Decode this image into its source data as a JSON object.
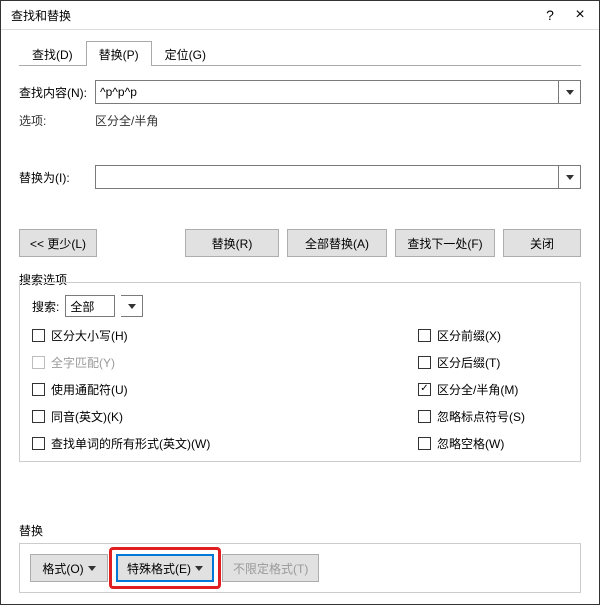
{
  "titlebar": {
    "title": "查找和替换",
    "help": "?",
    "close": "×"
  },
  "tabs": {
    "find": "查找(D)",
    "replace": "替换(P)",
    "goto": "定位(G)"
  },
  "labels": {
    "find_content": "查找内容(N):",
    "options": "选项:",
    "replace_with": "替换为(I):",
    "options_value": "区分全/半角",
    "search_options_title": "搜索选项",
    "search_label": "搜索:",
    "footer_label": "替换"
  },
  "fields": {
    "find_value": "^p^p^p",
    "replace_value": "",
    "search_scope": "全部"
  },
  "buttons": {
    "less": "<< 更少(L)",
    "replace": "替换(R)",
    "replace_all": "全部替换(A)",
    "find_next": "查找下一处(F)",
    "close": "关闭",
    "format": "格式(O)",
    "special": "特殊格式(E)",
    "no_format": "不限定格式(T)"
  },
  "checks": {
    "left": [
      {
        "label": "区分大小写(H)",
        "checked": false,
        "disabled": false
      },
      {
        "label": "全字匹配(Y)",
        "checked": false,
        "disabled": true
      },
      {
        "label": "使用通配符(U)",
        "checked": false,
        "disabled": false
      },
      {
        "label": "同音(英文)(K)",
        "checked": false,
        "disabled": false
      },
      {
        "label": "查找单词的所有形式(英文)(W)",
        "checked": false,
        "disabled": false
      }
    ],
    "right": [
      {
        "label": "区分前缀(X)",
        "checked": false,
        "disabled": false
      },
      {
        "label": "区分后缀(T)",
        "checked": false,
        "disabled": false
      },
      {
        "label": "区分全/半角(M)",
        "checked": true,
        "disabled": false
      },
      {
        "label": "忽略标点符号(S)",
        "checked": false,
        "disabled": false
      },
      {
        "label": "忽略空格(W)",
        "checked": false,
        "disabled": false
      }
    ]
  }
}
